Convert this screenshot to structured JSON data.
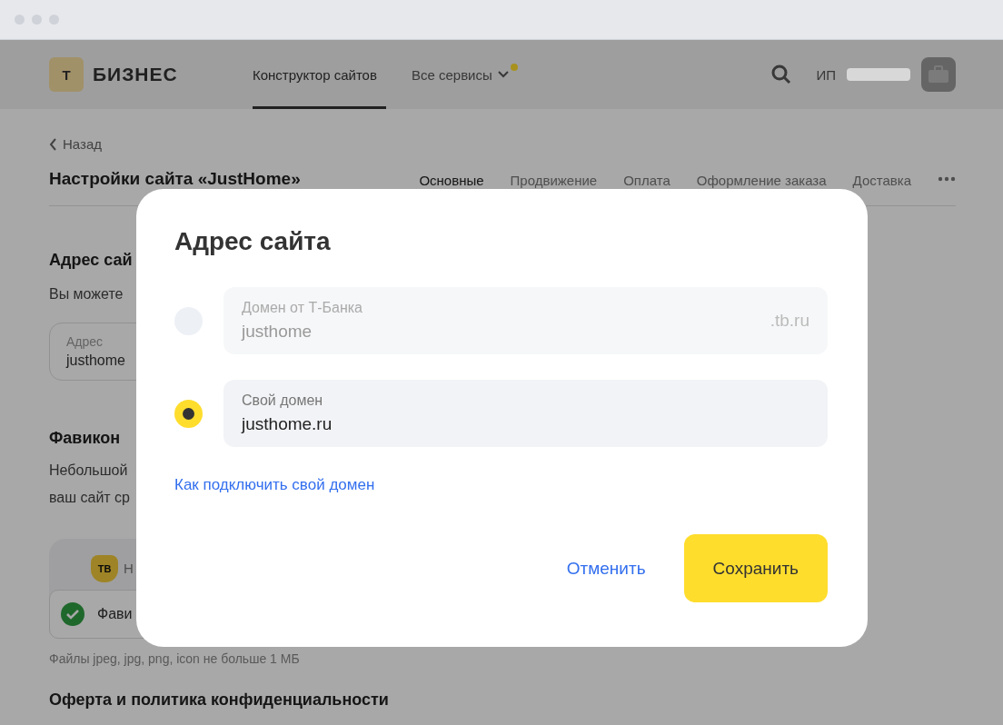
{
  "header": {
    "logo_mark": "Т",
    "logo": "БИЗНЕС",
    "nav": [
      {
        "label": "Конструктор сайтов",
        "selected": true,
        "has_dot": false
      },
      {
        "label": "Все сервисы",
        "selected": false,
        "has_dot": true
      }
    ],
    "account": "ИП"
  },
  "back": "Назад",
  "title": "Настройки сайта «JustHome»",
  "tabs": [
    {
      "label": "Основные",
      "selected": true
    },
    {
      "label": "Продвижение",
      "selected": false
    },
    {
      "label": "Оплата",
      "selected": false
    },
    {
      "label": "Оформление заказа",
      "selected": false
    },
    {
      "label": "Доставка",
      "selected": false
    }
  ],
  "address_heading": "Адрес сай",
  "address_text": "Вы можете",
  "address_field": {
    "label": "Адрес",
    "value": "justhome"
  },
  "favicon_heading": "Фавикон",
  "favicon_text": [
    "Небольшой",
    "ваш сайт ср"
  ],
  "favicon_card": {
    "badge": "ТВ",
    "tab_text": "Н",
    "file_text": "Фави",
    "uploaded": true
  },
  "hint": "Файлы jpeg, jpg, png, icon не больше 1 МБ",
  "next_heading": "Оферта и политика конфиденциальности",
  "dialog": {
    "title": "Адрес сайта",
    "options": [
      {
        "label": "Домен от Т-Банка",
        "value": "justhome",
        "suffix": ".tb.ru",
        "selected": false
      },
      {
        "label": "Свой домен",
        "value": "justhome.ru",
        "selected": true
      }
    ],
    "link": "Как подключить свой домен",
    "buttons": [
      {
        "label": "Отменить",
        "kind": "link"
      },
      {
        "label": "Сохранить",
        "kind": "primary"
      }
    ]
  }
}
